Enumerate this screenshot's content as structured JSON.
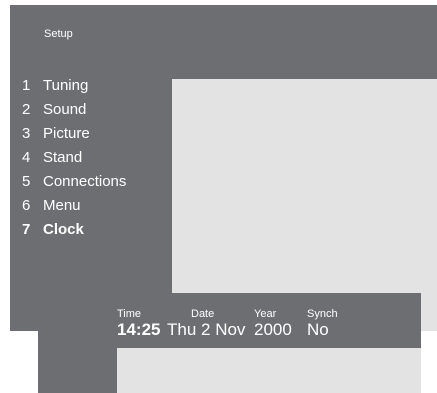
{
  "setup": {
    "title": "Setup",
    "menu": [
      {
        "num": "1",
        "label": "Tuning"
      },
      {
        "num": "2",
        "label": "Sound"
      },
      {
        "num": "3",
        "label": "Picture"
      },
      {
        "num": "4",
        "label": "Stand"
      },
      {
        "num": "5",
        "label": "Connections"
      },
      {
        "num": "6",
        "label": "Menu"
      },
      {
        "num": "7",
        "label": "Clock",
        "selected": true
      }
    ]
  },
  "clock": {
    "time_label": "Time",
    "time_value": "14:25",
    "date_label": "Date",
    "date_value": "Thu 2 Nov",
    "year_label": "Year",
    "year_value": "2000",
    "synch_label": "Synch",
    "synch_value": "No"
  },
  "colors": {
    "panel": "#6d6e71",
    "content": "#e3e3e3",
    "text": "#ffffff"
  }
}
